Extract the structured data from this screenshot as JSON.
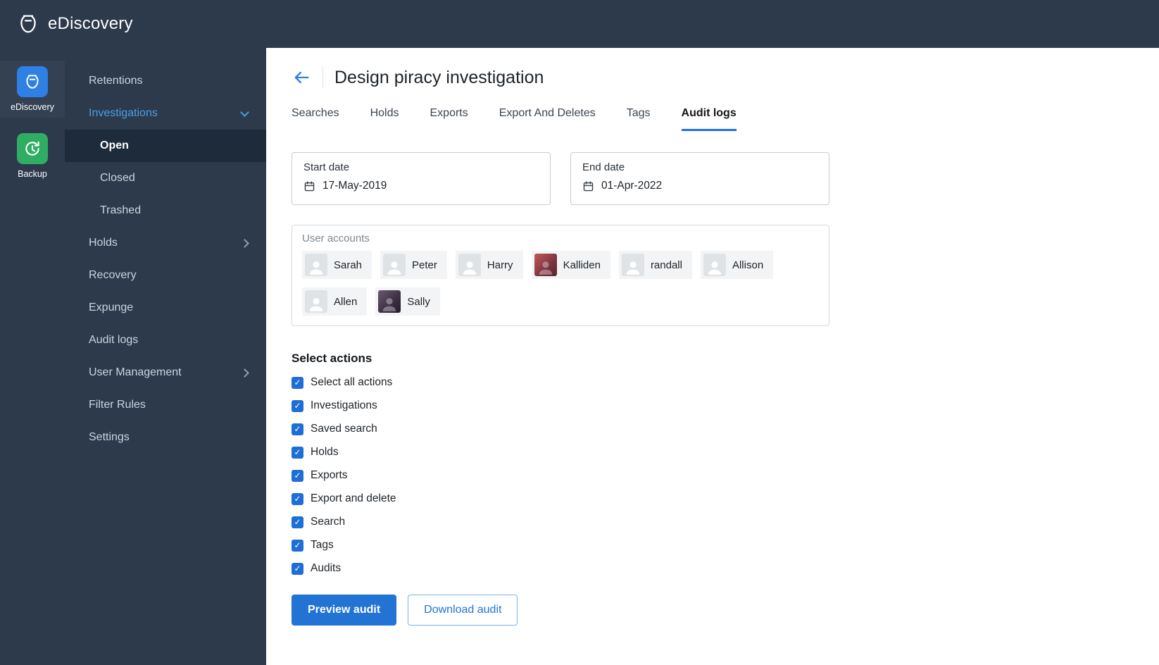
{
  "app": {
    "title": "eDiscovery"
  },
  "rail": {
    "items": [
      {
        "label": "eDiscovery",
        "active": true
      },
      {
        "label": "Backup",
        "active": false
      }
    ]
  },
  "sidebar": {
    "items": [
      {
        "label": "Retentions"
      },
      {
        "label": "Investigations",
        "expanded": true
      },
      {
        "label": "Open",
        "active": true
      },
      {
        "label": "Closed"
      },
      {
        "label": "Trashed"
      },
      {
        "label": "Holds"
      },
      {
        "label": "Recovery"
      },
      {
        "label": "Expunge"
      },
      {
        "label": "Audit logs"
      },
      {
        "label": "User Management"
      },
      {
        "label": "Filter Rules"
      },
      {
        "label": "Settings"
      }
    ]
  },
  "header": {
    "title": "Design piracy investigation"
  },
  "tabs": [
    {
      "label": "Searches",
      "active": false
    },
    {
      "label": "Holds",
      "active": false
    },
    {
      "label": "Exports",
      "active": false
    },
    {
      "label": "Export And Deletes",
      "active": false
    },
    {
      "label": "Tags",
      "active": false
    },
    {
      "label": "Audit logs",
      "active": true
    }
  ],
  "filters": {
    "start_date": {
      "label": "Start date",
      "value": "17-May-2019"
    },
    "end_date": {
      "label": "End date",
      "value": "01-Apr-2022"
    },
    "user_accounts": {
      "label": "User accounts",
      "users": [
        "Sarah",
        "Peter",
        "Harry",
        "Kalliden",
        "randall",
        "Allison",
        "Allen",
        "Sally"
      ]
    }
  },
  "actions": {
    "heading": "Select actions",
    "items": [
      {
        "label": "Select all actions",
        "checked": true
      },
      {
        "label": "Investigations",
        "checked": true
      },
      {
        "label": "Saved search",
        "checked": true
      },
      {
        "label": "Holds",
        "checked": true
      },
      {
        "label": "Exports",
        "checked": true
      },
      {
        "label": "Export and delete",
        "checked": true
      },
      {
        "label": "Search",
        "checked": true
      },
      {
        "label": "Tags",
        "checked": true
      },
      {
        "label": "Audits",
        "checked": true
      }
    ],
    "preview_label": "Preview audit",
    "download_label": "Download audit"
  },
  "colors": {
    "topbar": "#2c3a4c",
    "accent_blue": "#2273d4",
    "link_blue": "#4c9fe8",
    "active_row": "#1e2b3a",
    "backup_green": "#2fae63"
  }
}
